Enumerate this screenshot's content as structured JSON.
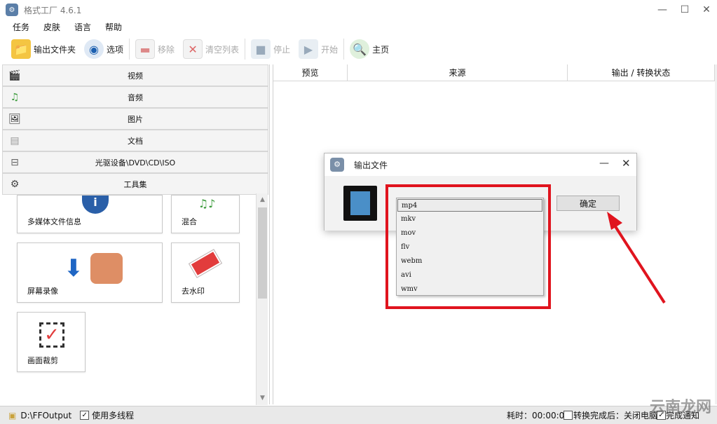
{
  "window": {
    "title": "格式工厂 4.6.1",
    "controls": {
      "minimize": "—",
      "maximize": "☐",
      "close": "✕"
    }
  },
  "menu": [
    "任务",
    "皮肤",
    "语言",
    "帮助"
  ],
  "toolbar": {
    "output_folder": "输出文件夹",
    "options": "选项",
    "remove": "移除",
    "clear_list": "清空列表",
    "stop": "停止",
    "start": "开始",
    "home": "主页"
  },
  "categories": [
    {
      "label": "视频",
      "icon": "film-icon"
    },
    {
      "label": "音频",
      "icon": "music-icon"
    },
    {
      "label": "图片",
      "icon": "picture-icon"
    },
    {
      "label": "文档",
      "icon": "document-icon"
    },
    {
      "label": "光驱设备\\DVD\\CD\\ISO",
      "icon": "disc-drive-icon"
    },
    {
      "label": "工具集",
      "icon": "toolbox-icon"
    }
  ],
  "tiles": {
    "media_info": "多媒体文件信息",
    "mix": "混合",
    "screen_record": "屏幕录像",
    "watermark": "去水印",
    "crop": "画面裁剪"
  },
  "columns": {
    "preview": "预览",
    "source": "来源",
    "status": "输出 / 转换状态"
  },
  "dialog": {
    "title": "输出文件",
    "ok": "确定",
    "formats": [
      "mp4",
      "mkv",
      "mov",
      "flv",
      "webm",
      "avi",
      "wmv"
    ],
    "selected": "mp4"
  },
  "status": {
    "output_path": "D:\\FFOutput",
    "multithread": "使用多线程",
    "elapsed": "耗时：00:00:00",
    "after_done": "转换完成后：关闭电脑",
    "notify": "完成通知"
  },
  "watermark": "云南龙网",
  "colors": {
    "highlight": "#e0141e"
  }
}
